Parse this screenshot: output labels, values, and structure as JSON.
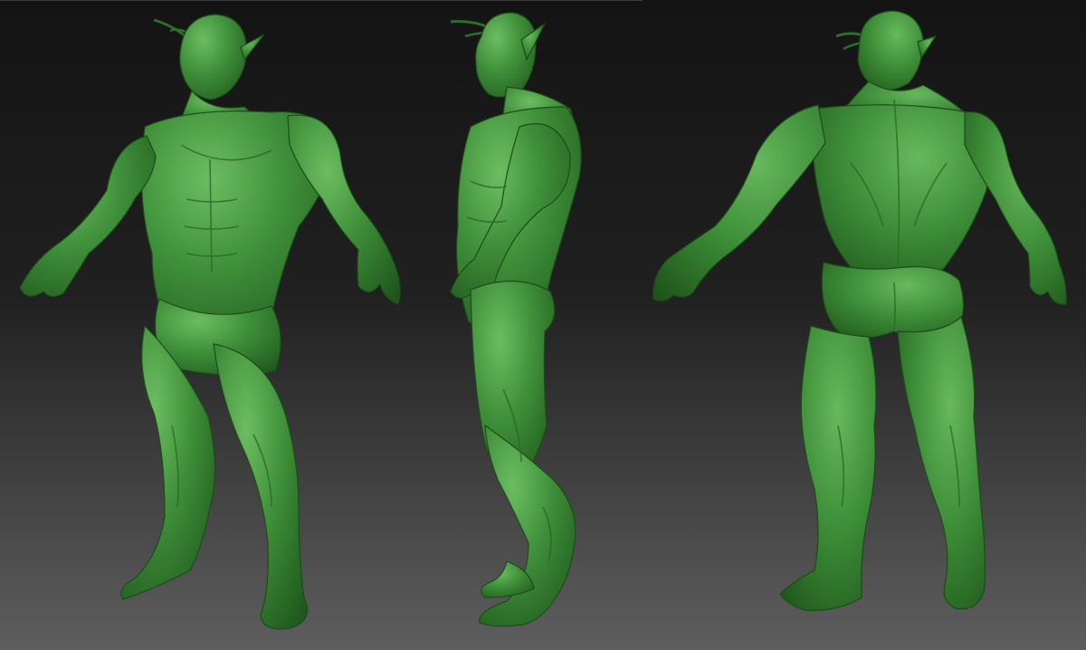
{
  "scene": {
    "background_top": "#141414",
    "background_bottom": "#5c5c5c",
    "clay_color": "#3f8f3a",
    "clay_shadow": "#1f5a1c",
    "clay_highlight": "#6fc064",
    "views": [
      {
        "id": "front-three-quarter",
        "label": ""
      },
      {
        "id": "side",
        "label": ""
      },
      {
        "id": "back-three-quarter",
        "label": ""
      }
    ]
  }
}
